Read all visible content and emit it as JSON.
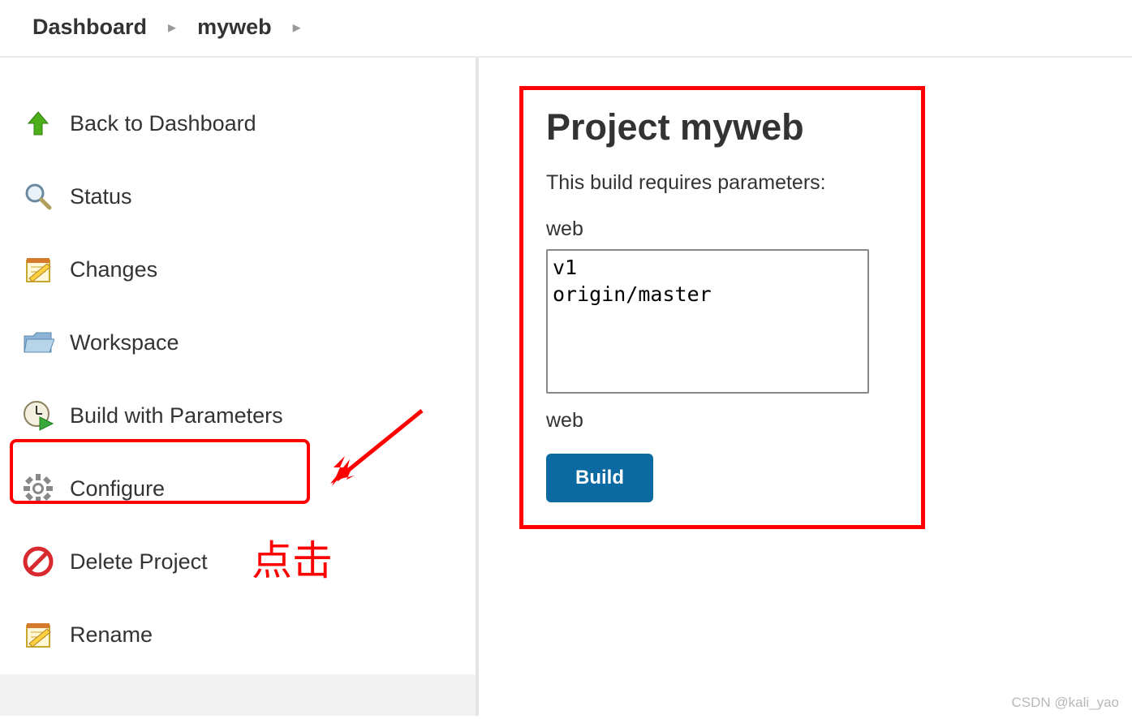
{
  "breadcrumb": {
    "items": [
      "Dashboard",
      "myweb"
    ]
  },
  "sidebar": {
    "items": [
      {
        "label": "Back to Dashboard",
        "name": "sidebar-item-back"
      },
      {
        "label": "Status",
        "name": "sidebar-item-status"
      },
      {
        "label": "Changes",
        "name": "sidebar-item-changes"
      },
      {
        "label": "Workspace",
        "name": "sidebar-item-workspace"
      },
      {
        "label": "Build with Parameters",
        "name": "sidebar-item-build-params"
      },
      {
        "label": "Configure",
        "name": "sidebar-item-configure"
      },
      {
        "label": "Delete Project",
        "name": "sidebar-item-delete"
      },
      {
        "label": "Rename",
        "name": "sidebar-item-rename"
      }
    ]
  },
  "annotation": {
    "click_label": "点击"
  },
  "content": {
    "title": "Project myweb",
    "param_intro": "This build requires parameters:",
    "param_label": "web",
    "options": [
      "v1",
      "origin/master"
    ],
    "param_desc": "web",
    "build_button": "Build"
  },
  "watermark": "CSDN @kali_yao"
}
